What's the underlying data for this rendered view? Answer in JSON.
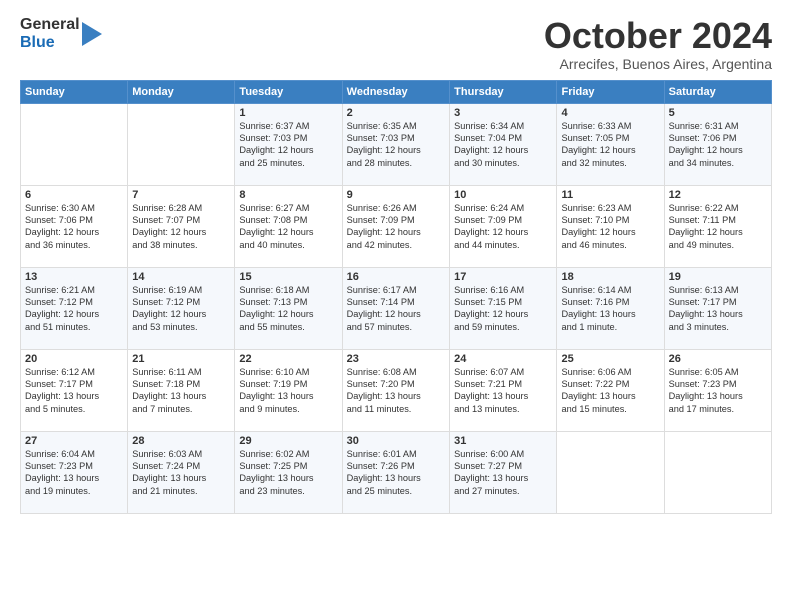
{
  "logo": {
    "general": "General",
    "blue": "Blue"
  },
  "title": "October 2024",
  "subtitle": "Arrecifes, Buenos Aires, Argentina",
  "days": [
    "Sunday",
    "Monday",
    "Tuesday",
    "Wednesday",
    "Thursday",
    "Friday",
    "Saturday"
  ],
  "weeks": [
    [
      {
        "day": "",
        "content": ""
      },
      {
        "day": "",
        "content": ""
      },
      {
        "day": "1",
        "content": "Sunrise: 6:37 AM\nSunset: 7:03 PM\nDaylight: 12 hours\nand 25 minutes."
      },
      {
        "day": "2",
        "content": "Sunrise: 6:35 AM\nSunset: 7:03 PM\nDaylight: 12 hours\nand 28 minutes."
      },
      {
        "day": "3",
        "content": "Sunrise: 6:34 AM\nSunset: 7:04 PM\nDaylight: 12 hours\nand 30 minutes."
      },
      {
        "day": "4",
        "content": "Sunrise: 6:33 AM\nSunset: 7:05 PM\nDaylight: 12 hours\nand 32 minutes."
      },
      {
        "day": "5",
        "content": "Sunrise: 6:31 AM\nSunset: 7:06 PM\nDaylight: 12 hours\nand 34 minutes."
      }
    ],
    [
      {
        "day": "6",
        "content": "Sunrise: 6:30 AM\nSunset: 7:06 PM\nDaylight: 12 hours\nand 36 minutes."
      },
      {
        "day": "7",
        "content": "Sunrise: 6:28 AM\nSunset: 7:07 PM\nDaylight: 12 hours\nand 38 minutes."
      },
      {
        "day": "8",
        "content": "Sunrise: 6:27 AM\nSunset: 7:08 PM\nDaylight: 12 hours\nand 40 minutes."
      },
      {
        "day": "9",
        "content": "Sunrise: 6:26 AM\nSunset: 7:09 PM\nDaylight: 12 hours\nand 42 minutes."
      },
      {
        "day": "10",
        "content": "Sunrise: 6:24 AM\nSunset: 7:09 PM\nDaylight: 12 hours\nand 44 minutes."
      },
      {
        "day": "11",
        "content": "Sunrise: 6:23 AM\nSunset: 7:10 PM\nDaylight: 12 hours\nand 46 minutes."
      },
      {
        "day": "12",
        "content": "Sunrise: 6:22 AM\nSunset: 7:11 PM\nDaylight: 12 hours\nand 49 minutes."
      }
    ],
    [
      {
        "day": "13",
        "content": "Sunrise: 6:21 AM\nSunset: 7:12 PM\nDaylight: 12 hours\nand 51 minutes."
      },
      {
        "day": "14",
        "content": "Sunrise: 6:19 AM\nSunset: 7:12 PM\nDaylight: 12 hours\nand 53 minutes."
      },
      {
        "day": "15",
        "content": "Sunrise: 6:18 AM\nSunset: 7:13 PM\nDaylight: 12 hours\nand 55 minutes."
      },
      {
        "day": "16",
        "content": "Sunrise: 6:17 AM\nSunset: 7:14 PM\nDaylight: 12 hours\nand 57 minutes."
      },
      {
        "day": "17",
        "content": "Sunrise: 6:16 AM\nSunset: 7:15 PM\nDaylight: 12 hours\nand 59 minutes."
      },
      {
        "day": "18",
        "content": "Sunrise: 6:14 AM\nSunset: 7:16 PM\nDaylight: 13 hours\nand 1 minute."
      },
      {
        "day": "19",
        "content": "Sunrise: 6:13 AM\nSunset: 7:17 PM\nDaylight: 13 hours\nand 3 minutes."
      }
    ],
    [
      {
        "day": "20",
        "content": "Sunrise: 6:12 AM\nSunset: 7:17 PM\nDaylight: 13 hours\nand 5 minutes."
      },
      {
        "day": "21",
        "content": "Sunrise: 6:11 AM\nSunset: 7:18 PM\nDaylight: 13 hours\nand 7 minutes."
      },
      {
        "day": "22",
        "content": "Sunrise: 6:10 AM\nSunset: 7:19 PM\nDaylight: 13 hours\nand 9 minutes."
      },
      {
        "day": "23",
        "content": "Sunrise: 6:08 AM\nSunset: 7:20 PM\nDaylight: 13 hours\nand 11 minutes."
      },
      {
        "day": "24",
        "content": "Sunrise: 6:07 AM\nSunset: 7:21 PM\nDaylight: 13 hours\nand 13 minutes."
      },
      {
        "day": "25",
        "content": "Sunrise: 6:06 AM\nSunset: 7:22 PM\nDaylight: 13 hours\nand 15 minutes."
      },
      {
        "day": "26",
        "content": "Sunrise: 6:05 AM\nSunset: 7:23 PM\nDaylight: 13 hours\nand 17 minutes."
      }
    ],
    [
      {
        "day": "27",
        "content": "Sunrise: 6:04 AM\nSunset: 7:23 PM\nDaylight: 13 hours\nand 19 minutes."
      },
      {
        "day": "28",
        "content": "Sunrise: 6:03 AM\nSunset: 7:24 PM\nDaylight: 13 hours\nand 21 minutes."
      },
      {
        "day": "29",
        "content": "Sunrise: 6:02 AM\nSunset: 7:25 PM\nDaylight: 13 hours\nand 23 minutes."
      },
      {
        "day": "30",
        "content": "Sunrise: 6:01 AM\nSunset: 7:26 PM\nDaylight: 13 hours\nand 25 minutes."
      },
      {
        "day": "31",
        "content": "Sunrise: 6:00 AM\nSunset: 7:27 PM\nDaylight: 13 hours\nand 27 minutes."
      },
      {
        "day": "",
        "content": ""
      },
      {
        "day": "",
        "content": ""
      }
    ]
  ]
}
